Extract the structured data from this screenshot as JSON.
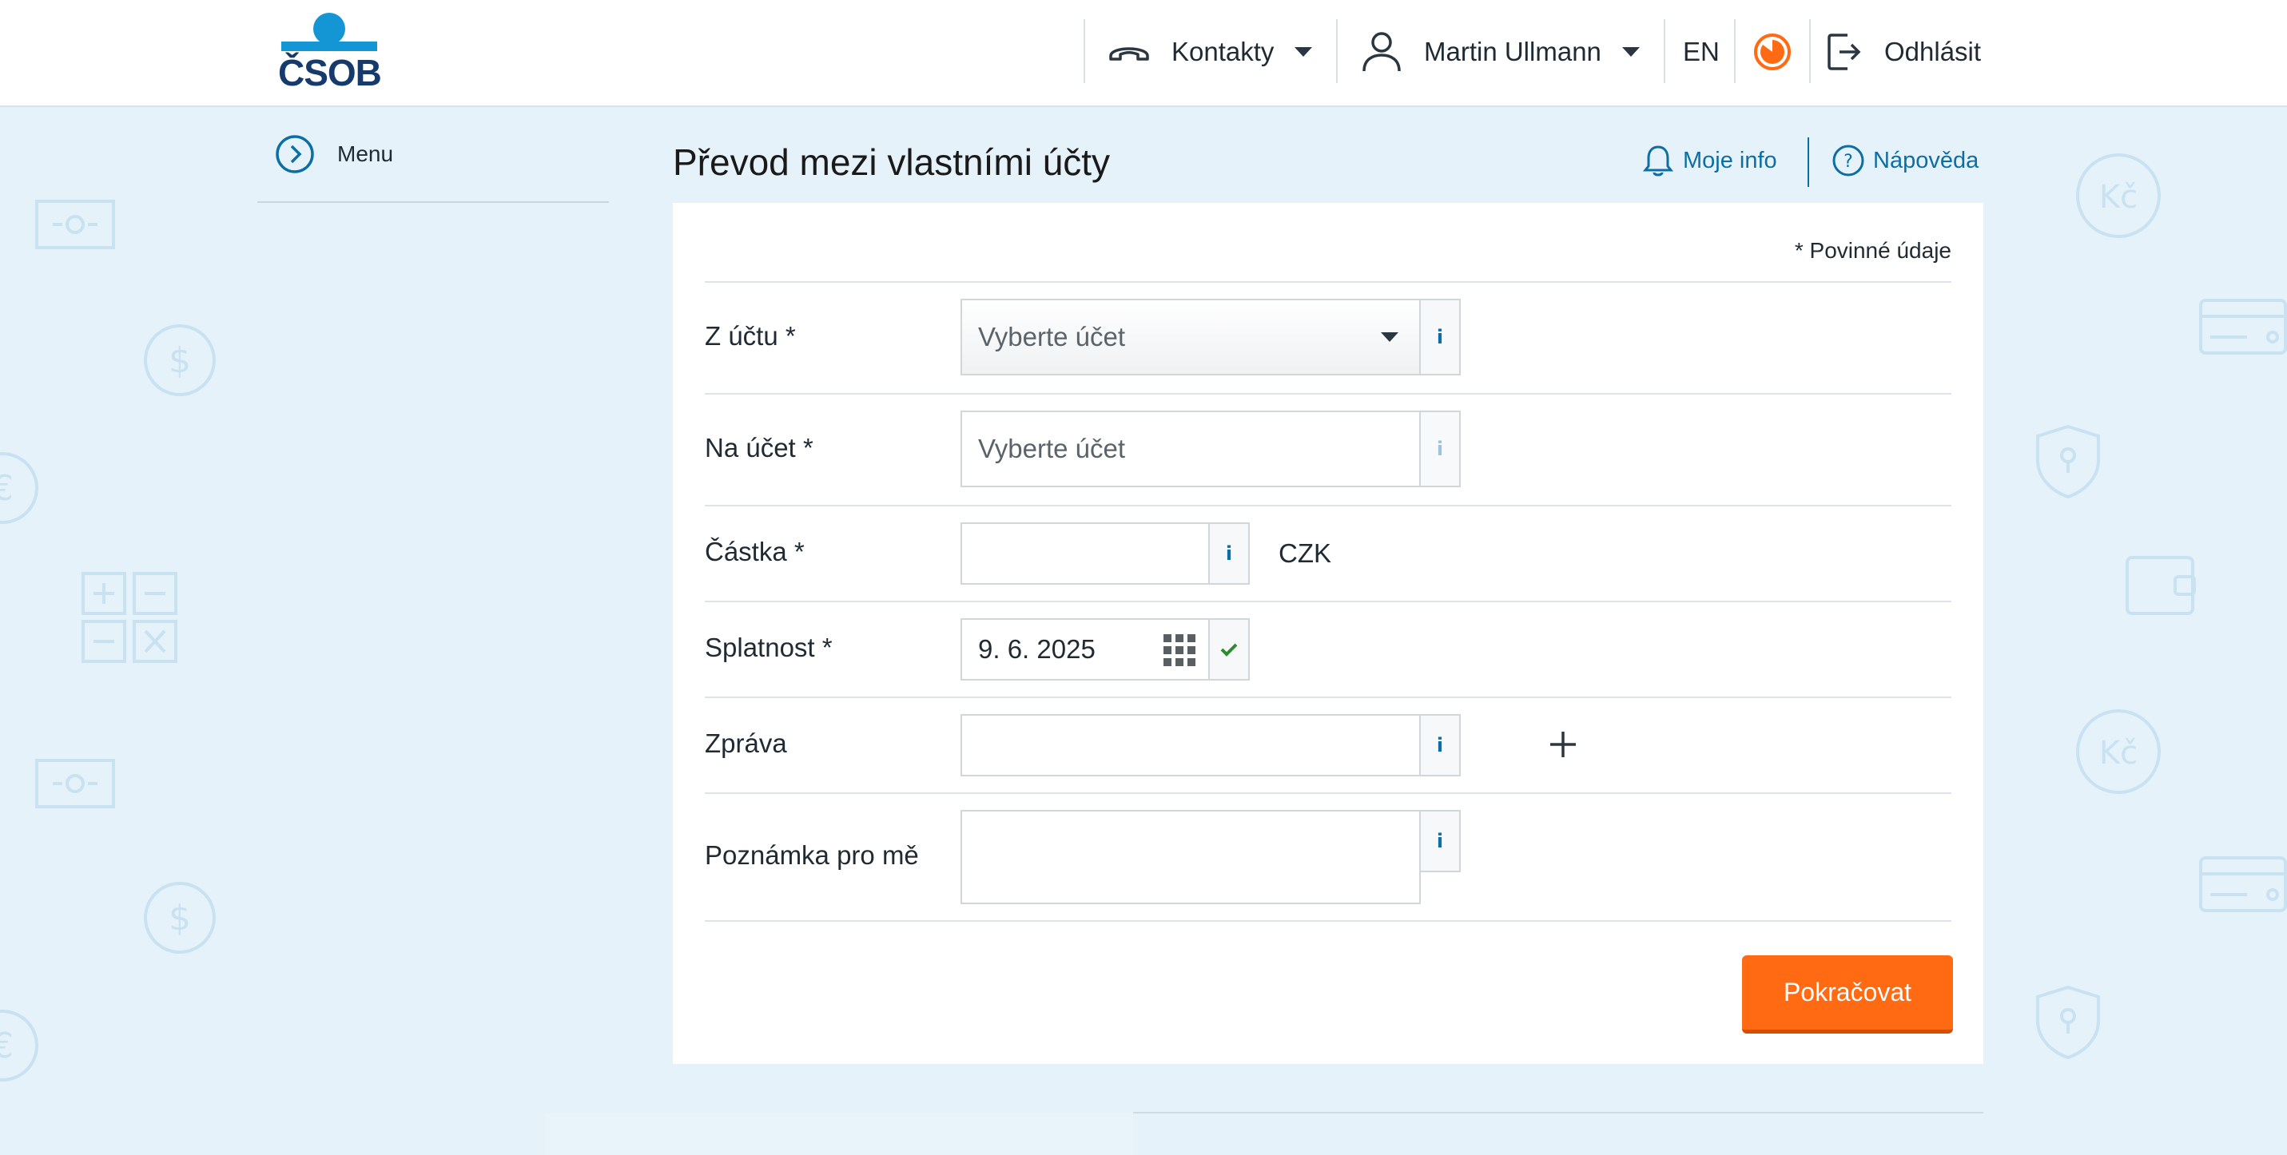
{
  "header": {
    "logo_text": "ČSOB",
    "contacts_label": "Kontakty",
    "user_name": "Martin Ullmann",
    "language": "EN",
    "logout_label": "Odhlásit"
  },
  "menu": {
    "label": "Menu"
  },
  "page": {
    "title": "Převod mezi vlastními účty",
    "my_info_label": "Moje info",
    "help_label": "Nápověda"
  },
  "form": {
    "required_note": "* Povinné údaje",
    "from_account": {
      "label": "Z účtu *",
      "placeholder": "Vyberte účet"
    },
    "to_account": {
      "label": "Na účet *",
      "placeholder": "Vyberte účet"
    },
    "amount": {
      "label": "Částka *",
      "value": "",
      "currency": "CZK"
    },
    "due_date": {
      "label": "Splatnost *",
      "value": "9. 6. 2025"
    },
    "message": {
      "label": "Zpráva",
      "value": ""
    },
    "note": {
      "label": "Poznámka pro mě",
      "value": ""
    },
    "info_symbol": "i",
    "continue_label": "Pokračovat"
  },
  "colors": {
    "accent": "#0d6ea5",
    "primary_button": "#ff6a13",
    "background": "#e6f2fa",
    "check_green": "#2e8b2e"
  }
}
